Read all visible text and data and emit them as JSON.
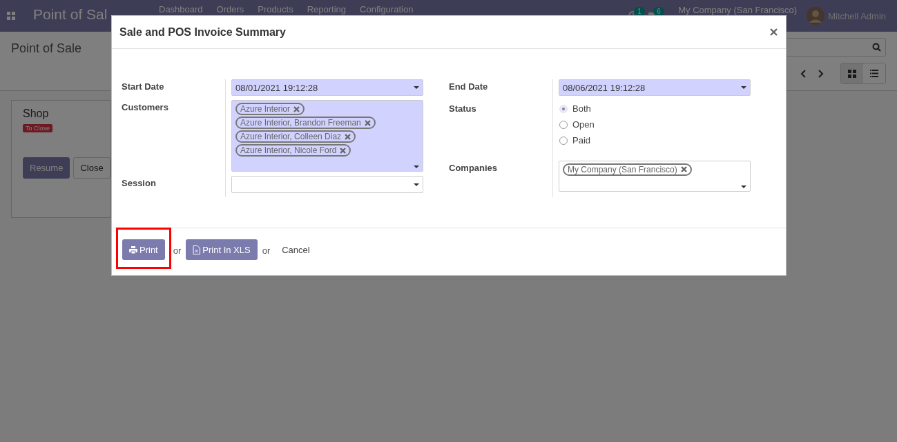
{
  "navbar": {
    "app_name": "Point of Sal",
    "menu": [
      "Dashboard",
      "Orders",
      "Products",
      "Reporting",
      "Configuration"
    ],
    "activity_count": "1",
    "message_count": "6",
    "company": "My Company (San Francisco)",
    "user": "Mitchell Admin"
  },
  "control_panel": {
    "breadcrumb": "Point of Sale",
    "views": [
      {
        "kind": "kanban",
        "selected": true
      },
      {
        "kind": "list",
        "selected": false
      }
    ]
  },
  "kanban_card": {
    "title": "Shop",
    "status": "To Close",
    "buttons": [
      {
        "label": "Resume",
        "kind": "primary"
      },
      {
        "label": "Close",
        "kind": "secondary"
      }
    ]
  },
  "dialog": {
    "title": "Sale and POS Invoice Summary",
    "left_fields": [
      {
        "label": "Start Date",
        "kind": "date",
        "value": "08/01/2021 19:12:28",
        "required": true
      },
      {
        "label": "Customers",
        "kind": "tags",
        "tags": [
          "Azure Interior",
          "Azure Interior, Brandon Freeman",
          "Azure Interior, Colleen Diaz",
          "Azure Interior, Nicole Ford"
        ],
        "required": true
      },
      {
        "label": "Session",
        "kind": "select",
        "required": false
      }
    ],
    "right_fields": [
      {
        "label": "End Date",
        "kind": "date",
        "value": "08/06/2021 19:12:28",
        "required": true
      },
      {
        "label": "Status",
        "kind": "radio",
        "options": [
          {
            "label": "Both",
            "selected": true
          },
          {
            "label": "Open",
            "selected": false
          },
          {
            "label": "Paid",
            "selected": false
          }
        ]
      },
      {
        "label": "Companies",
        "kind": "tags",
        "tags": [
          "My Company (San Francisco)"
        ],
        "required": false
      }
    ],
    "actions": [
      {
        "kind": "print_button",
        "label": "Print",
        "highlighted": true
      },
      {
        "kind": "separator",
        "label": "or"
      },
      {
        "kind": "xls_button",
        "label": "Print In XLS",
        "highlighted": false
      },
      {
        "kind": "separator",
        "label": "or"
      },
      {
        "kind": "link",
        "label": "Cancel"
      }
    ]
  }
}
